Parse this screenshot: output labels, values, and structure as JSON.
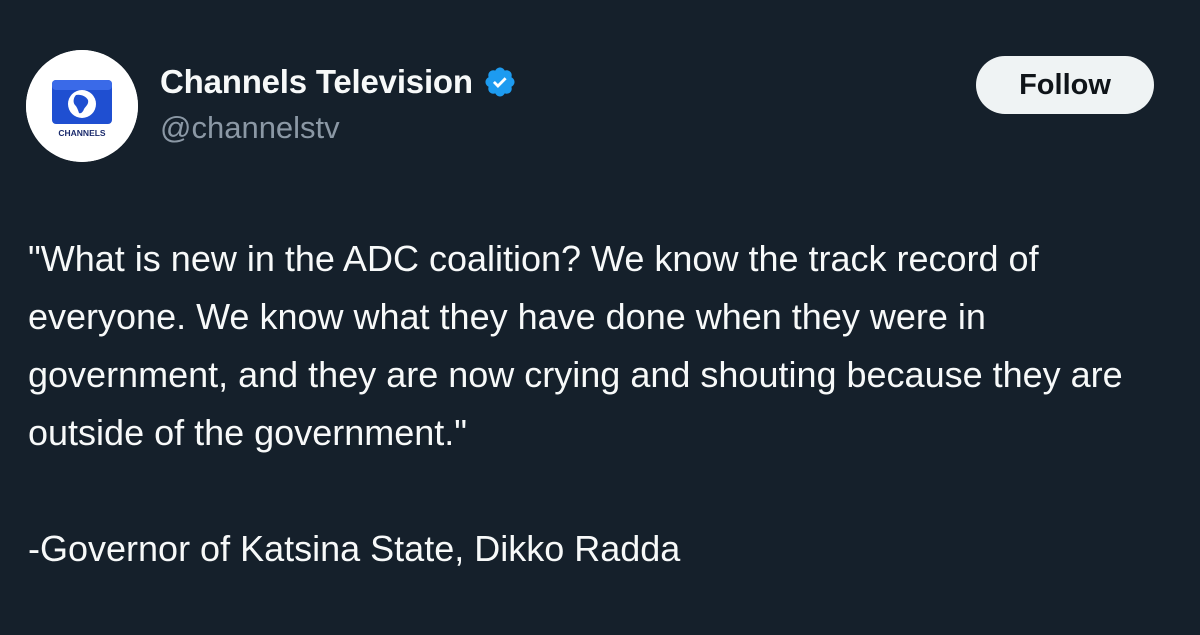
{
  "post": {
    "author": {
      "display_name": "Channels Television",
      "handle": "@channelstv",
      "verified": true,
      "avatar_logo_text": "CHANNELS"
    },
    "follow_label": "Follow",
    "body": {
      "quote": "\"What is new in the ADC coalition? We know the track record of everyone. We know what they have done when they were in government, and they are now crying and shouting because they are outside of the government.\"",
      "attribution": "-Governor of Katsina State, Dikko Radda"
    }
  },
  "colors": {
    "background": "#15202b",
    "text_primary": "#f7f9f9",
    "text_secondary": "#8b98a5",
    "verified_badge": "#1d9bf0",
    "follow_button_bg": "#eff3f4",
    "follow_button_text": "#0f1419",
    "logo_blue": "#1f4fd1"
  },
  "icons": {
    "verified": "verified-badge-icon",
    "avatar": "channels-logo"
  }
}
